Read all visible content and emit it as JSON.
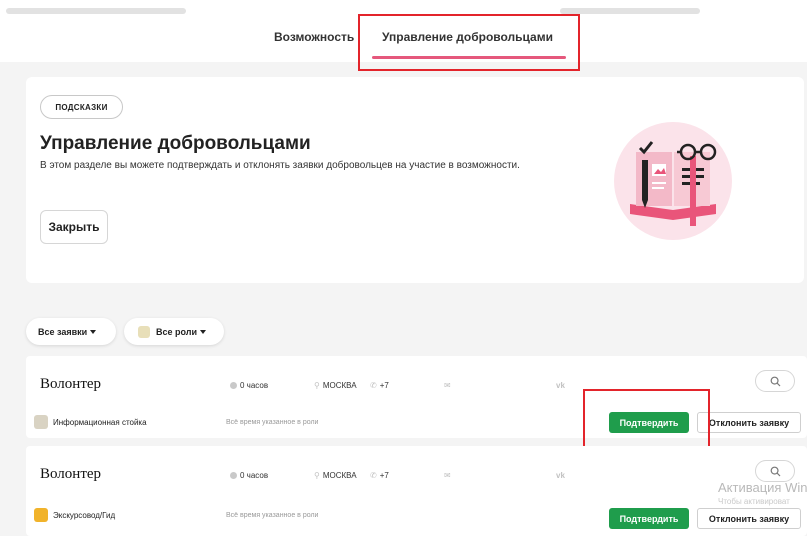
{
  "tabs": [
    {
      "label": "Возможность",
      "active": false
    },
    {
      "label": "Управление добровольцами",
      "active": true
    }
  ],
  "hint": {
    "badge": "ПОДСКАЗКИ",
    "title": "Управление добровольцами",
    "text": "В этом разделе вы можете подтверждать и отклонять заявки добровольцев на участие в возможности.",
    "close_label": "Закрыть"
  },
  "filters": {
    "requests_label": "Все заявки",
    "roles_label": "Все роли"
  },
  "applications": [
    {
      "title": "Волонтер",
      "hours": "0 часов",
      "city": "МОСКВА",
      "phone": "+7",
      "role": "Информационная стойка",
      "role_color": "#d9d3c3",
      "time_note": "Всё время указанное в роли",
      "confirm_label": "Подтвердить",
      "reject_label": "Отклонить заявку"
    },
    {
      "title": "Волонтер",
      "hours": "0 часов",
      "city": "МОСКВА",
      "phone": "+7",
      "role": "Экскурсовод/Гид",
      "role_color": "#f1b32b",
      "time_note": "Всё время указанное в роли",
      "confirm_label": "Подтвердить",
      "reject_label": "Отклонить заявку"
    }
  ],
  "watermark": {
    "title": "Активация Win",
    "subtitle": "Чтобы активироват"
  },
  "colors": {
    "accent": "#e5587c",
    "confirm": "#1f9d4c",
    "highlight_frame": "#e3242b"
  }
}
